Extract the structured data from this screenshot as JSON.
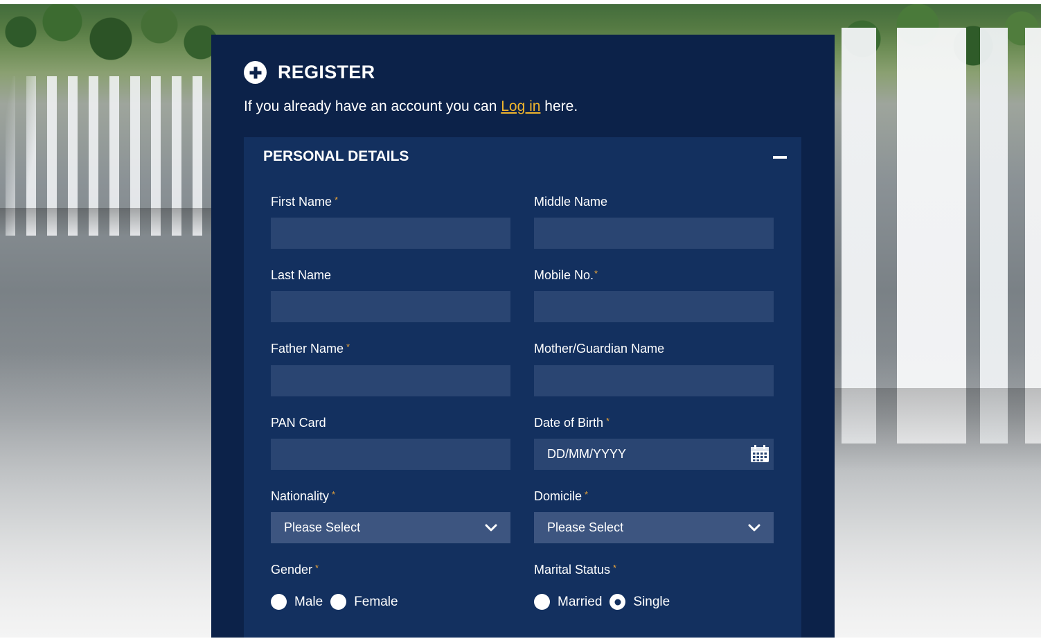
{
  "register": {
    "title": "REGISTER",
    "login_prefix": "If you already have an account you can ",
    "login_link": "Log in",
    "login_suffix": " here."
  },
  "section": {
    "title": "PERSONAL DETAILS",
    "collapse_icon": "minus-icon"
  },
  "fields": {
    "first_name": {
      "label": "First Name",
      "required": true,
      "value": ""
    },
    "middle_name": {
      "label": "Middle Name",
      "required": false,
      "value": ""
    },
    "last_name": {
      "label": "Last Name",
      "required": false,
      "value": ""
    },
    "mobile_no": {
      "label": "Mobile No.",
      "required": true,
      "value": ""
    },
    "father_name": {
      "label": "Father Name",
      "required": true,
      "value": ""
    },
    "mother_guardian_name": {
      "label": "Mother/Guardian Name",
      "required": false,
      "value": ""
    },
    "pan_card": {
      "label": "PAN Card",
      "required": false,
      "value": ""
    },
    "date_of_birth": {
      "label": "Date of Birth",
      "required": true,
      "placeholder": "DD/MM/YYYY",
      "icon": "calendar-icon"
    },
    "nationality": {
      "label": "Nationality",
      "required": true,
      "selected": "Please Select"
    },
    "domicile": {
      "label": "Domicile",
      "required": true,
      "selected": "Please Select"
    },
    "gender": {
      "label": "Gender",
      "required": true,
      "options": [
        "Male",
        "Female"
      ],
      "selected": null
    },
    "marital_status": {
      "label": "Marital Status",
      "required": true,
      "options": [
        "Married",
        "Single"
      ],
      "selected": "Single"
    }
  },
  "required_marker": "*",
  "colors": {
    "panel_bg": "#0c2249",
    "section_bg": "#13305f",
    "input_bg": "#2a4572",
    "select_bg": "#3d5580",
    "link": "#f0b52d",
    "required": "#e8a33a"
  }
}
